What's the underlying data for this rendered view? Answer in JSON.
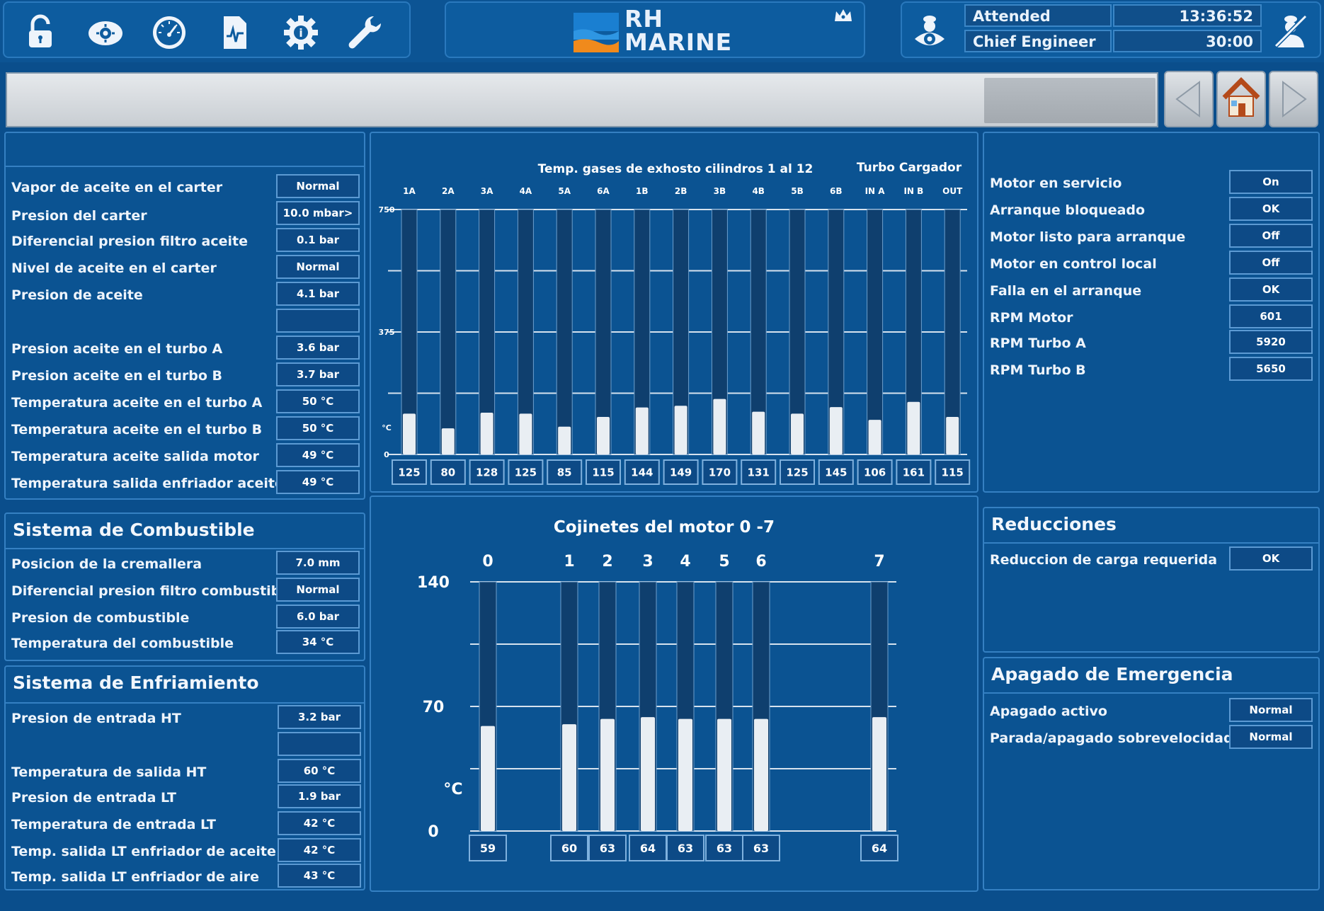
{
  "topbar": {
    "icons": [
      "unlock-icon",
      "engine-settings-icon",
      "gauge-icon",
      "document-chart-icon",
      "info-gear-icon",
      "wrench-icon"
    ],
    "logo": {
      "line1": "RH",
      "line2": "MARINE"
    },
    "status": {
      "attended_label": "Attended",
      "time": "13:36:52",
      "role": "Chief Engineer",
      "timer": "30:00"
    }
  },
  "oil_panel": {
    "title": "",
    "rows": [
      {
        "label": "Vapor de aceite en el carter",
        "value": "Normal"
      },
      {
        "label": "Presion del carter",
        "value": "10.0 mbar>"
      },
      {
        "label": "Diferencial presion filtro aceite",
        "value": "0.1 bar"
      },
      {
        "label": "Nivel de aceite en el carter",
        "value": "Normal"
      },
      {
        "label": "Presion de aceite",
        "value": "4.1 bar"
      },
      {
        "label": "",
        "value": ""
      },
      {
        "label": "Presion aceite en el turbo A",
        "value": "3.6 bar"
      },
      {
        "label": "Presion aceite en el turbo B",
        "value": "3.7 bar"
      },
      {
        "label": "Temperatura aceite en el turbo A",
        "value": "50 °C"
      },
      {
        "label": "Temperatura aceite en el turbo B",
        "value": "50 °C"
      },
      {
        "label": "Temperatura aceite salida motor",
        "value": "49 °C"
      },
      {
        "label": "Temperatura salida enfriador aceite",
        "value": "49 °C"
      }
    ]
  },
  "fuel_panel": {
    "title": "Sistema de Combustible",
    "rows": [
      {
        "label": "Posicion de la cremallera",
        "value": "7.0 mm"
      },
      {
        "label": "Diferencial presion filtro combustible",
        "value": "Normal"
      },
      {
        "label": "Presion de combustible",
        "value": "6.0 bar"
      },
      {
        "label": "Temperatura del combustible",
        "value": "34 °C"
      }
    ]
  },
  "cooling_panel": {
    "title": "Sistema de Enfriamiento",
    "rows": [
      {
        "label": "Presion de entrada HT",
        "value": "3.2 bar"
      },
      {
        "label": "",
        "value": ""
      },
      {
        "label": "Temperatura de salida HT",
        "value": "60 °C"
      },
      {
        "label": "Presion de entrada LT",
        "value": "1.9 bar"
      },
      {
        "label": "Temperatura de entrada LT",
        "value": "42 °C"
      },
      {
        "label": "Temp. salida LT enfriador de aceite",
        "value": "42 °C"
      },
      {
        "label": "Temp. salida LT enfriador de aire",
        "value": "43 °C"
      }
    ]
  },
  "engine_panel": {
    "rows": [
      {
        "label": "Motor en servicio",
        "value": "On"
      },
      {
        "label": "Arranque bloqueado",
        "value": "OK"
      },
      {
        "label": "Motor listo para arranque",
        "value": "Off"
      },
      {
        "label": "Motor en control local",
        "value": "Off"
      },
      {
        "label": "Falla en el arranque",
        "value": "OK"
      },
      {
        "label": "RPM Motor",
        "value": "601"
      },
      {
        "label": "RPM Turbo A",
        "value": "5920"
      },
      {
        "label": "RPM Turbo B",
        "value": "5650"
      }
    ]
  },
  "reductions_panel": {
    "title": "Reducciones",
    "rows": [
      {
        "label": "Reduccion de carga requerida",
        "value": "OK"
      }
    ]
  },
  "emergency_panel": {
    "title": "Apagado de Emergencia",
    "rows": [
      {
        "label": "Apagado activo",
        "value": "Normal"
      },
      {
        "label": "Parada/apagado sobrevelocidad",
        "value": "Normal"
      }
    ]
  },
  "chart_data": [
    {
      "type": "bar",
      "title": "Temp. gases de exhosto cilindros 1 al 12",
      "group_label": "Turbo Cargador",
      "categories": [
        "1A",
        "2A",
        "3A",
        "4A",
        "5A",
        "6A",
        "1B",
        "2B",
        "3B",
        "4B",
        "5B",
        "6B",
        "IN A",
        "IN B",
        "OUT"
      ],
      "values": [
        125,
        80,
        128,
        125,
        85,
        115,
        144,
        149,
        170,
        131,
        125,
        145,
        106,
        161,
        115
      ],
      "value_labels": [
        "125",
        "80",
        "128",
        "125",
        "85",
        "115",
        "144",
        "149",
        "170",
        "131",
        "125",
        "145",
        "106",
        "161",
        "115"
      ],
      "ylabel": "°C",
      "yticks": [
        "750",
        "375",
        "0"
      ],
      "ylim": [
        0,
        750
      ],
      "grid": true,
      "bar_color": "#e9eef3"
    },
    {
      "type": "bar",
      "title": "Cojinetes del motor 0 -7",
      "categories": [
        "0",
        "1",
        "2",
        "3",
        "4",
        "5",
        "6",
        "7"
      ],
      "values": [
        59,
        60,
        63,
        64,
        63,
        63,
        63,
        64
      ],
      "value_labels": [
        "59",
        "60",
        "63",
        "64",
        "63",
        "63",
        "63",
        "64"
      ],
      "ylabel": "°C",
      "yticks": [
        "140",
        "70",
        "0"
      ],
      "ylim": [
        0,
        140
      ],
      "grid": true,
      "bar_color": "#e9eef3"
    }
  ]
}
